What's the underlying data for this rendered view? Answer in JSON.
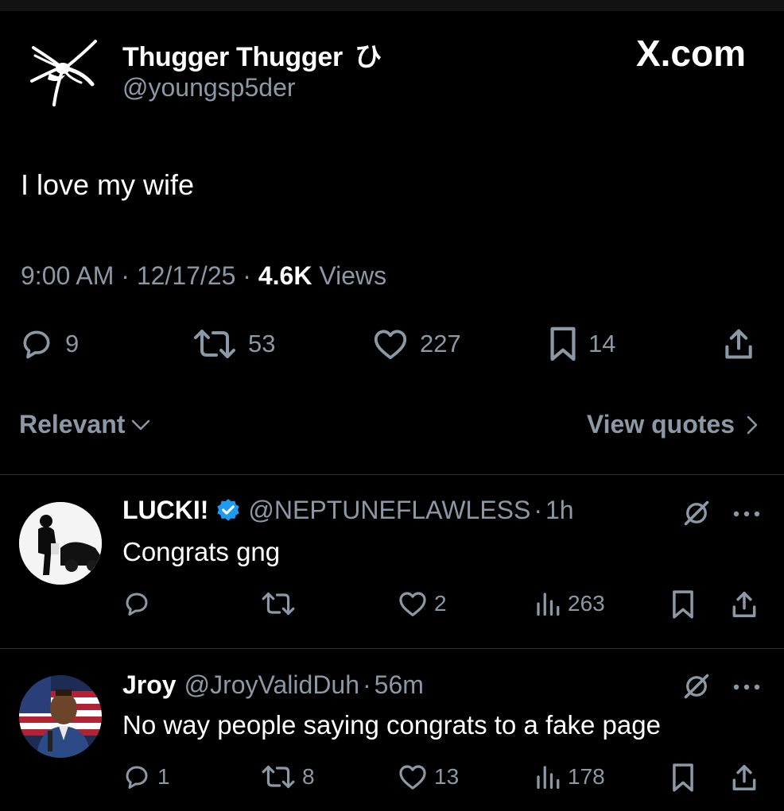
{
  "tweet": {
    "author_name": "Thugger Thugger",
    "author_symbol": "ひ",
    "author_handle": "@youngsp5der",
    "brand": "X.com",
    "text": "I love my wife",
    "time": "9:00 AM",
    "sep1": "·",
    "date": "12/17/25",
    "sep2": "·",
    "views_count": "4.6K",
    "views_label": "Views",
    "stats": {
      "replies": "9",
      "reposts": "53",
      "likes": "227",
      "bookmarks": "14"
    }
  },
  "sort": {
    "label": "Relevant",
    "view_quotes": "View quotes"
  },
  "replies": [
    {
      "name": "LUCKI!",
      "verified": true,
      "handle": "@NEPTUNEFLAWLESS",
      "sep": "·",
      "time": "1h",
      "text": "Congrats gng",
      "replies": "",
      "reposts": "",
      "likes": "2",
      "views": "263"
    },
    {
      "name": "Jroy",
      "verified": false,
      "handle": "@JroyValidDuh",
      "sep": "·",
      "time": "56m",
      "text": "No way people saying congrats to a fake page",
      "replies": "1",
      "reposts": "8",
      "likes": "13",
      "views": "178"
    }
  ],
  "colors": {
    "background": "#000000",
    "text_primary": "#ffffff",
    "text_secondary": "#8b98a5",
    "verified": "#1d9bf0",
    "divider": "#2f3336"
  },
  "icons": [
    "reply-icon",
    "repost-icon",
    "like-icon",
    "bookmark-icon",
    "share-icon",
    "views-icon",
    "grok-icon",
    "more-icon",
    "verified-icon",
    "chevron-down-icon",
    "chevron-right-icon"
  ]
}
